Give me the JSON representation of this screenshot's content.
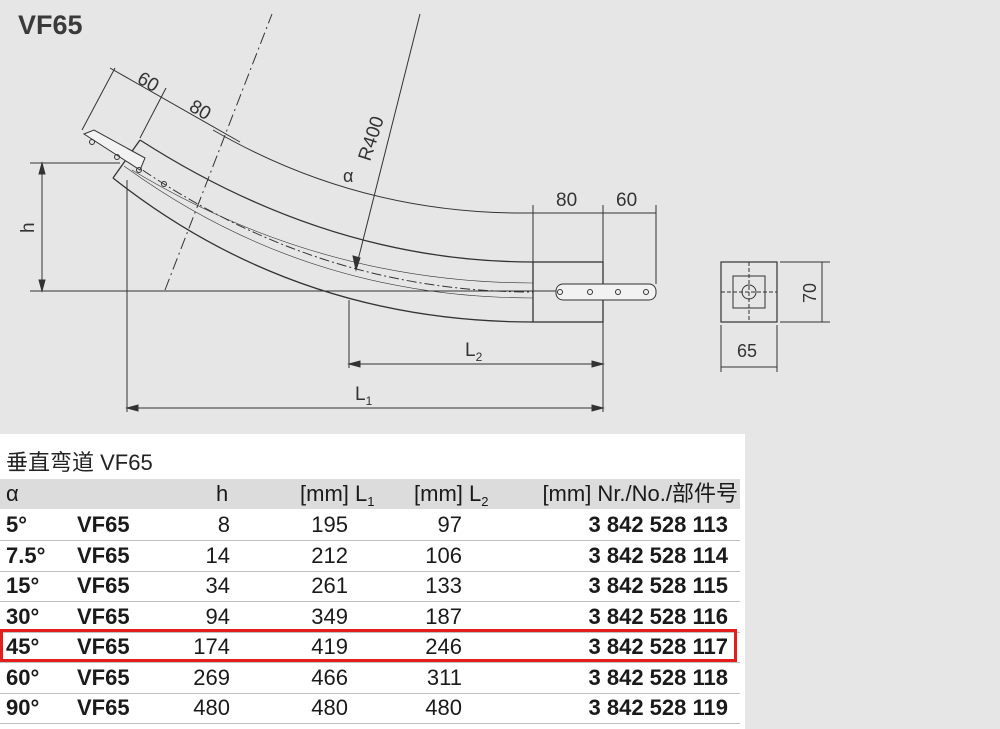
{
  "drawing": {
    "title": "VF65",
    "dimensions": {
      "first_segment": "60",
      "second_segment": "80",
      "radius": "R400",
      "angle": "α",
      "straight_80": "80",
      "straight_60": "60",
      "height": "h",
      "l2_letter": "L",
      "l2_sub": "2",
      "l1_letter": "L",
      "l1_sub": "1",
      "profile_height": "70",
      "profile_width": "65"
    }
  },
  "table": {
    "caption": "垂直弯道 VF65",
    "headers": {
      "angle": "α",
      "h": "h",
      "l1_unit": "[mm] L",
      "l1_sub": "1",
      "l2_unit": "[mm] L",
      "l2_sub": "2",
      "part": "[mm] Nr./No./部件号"
    },
    "rows": [
      {
        "angle": "5°",
        "model": "VF65",
        "h": "8",
        "l1": "195",
        "l2": "97",
        "part": "3 842 528 113"
      },
      {
        "angle": "7.5°",
        "model": "VF65",
        "h": "14",
        "l1": "212",
        "l2": "106",
        "part": "3 842 528 114"
      },
      {
        "angle": "15°",
        "model": "VF65",
        "h": "34",
        "l1": "261",
        "l2": "133",
        "part": "3 842 528 115"
      },
      {
        "angle": "30°",
        "model": "VF65",
        "h": "94",
        "l1": "349",
        "l2": "187",
        "part": "3 842 528 116"
      },
      {
        "angle": "45°",
        "model": "VF65",
        "h": "174",
        "l1": "419",
        "l2": "246",
        "part": "3 842 528 117"
      },
      {
        "angle": "60°",
        "model": "VF65",
        "h": "269",
        "l1": "466",
        "l2": "311",
        "part": "3 842 528 118"
      },
      {
        "angle": "90°",
        "model": "VF65",
        "h": "480",
        "l1": "480",
        "l2": "480",
        "part": "3 842 528 119"
      }
    ],
    "highlighted_row": "45°",
    "highlight_color": "#e41e1e"
  }
}
